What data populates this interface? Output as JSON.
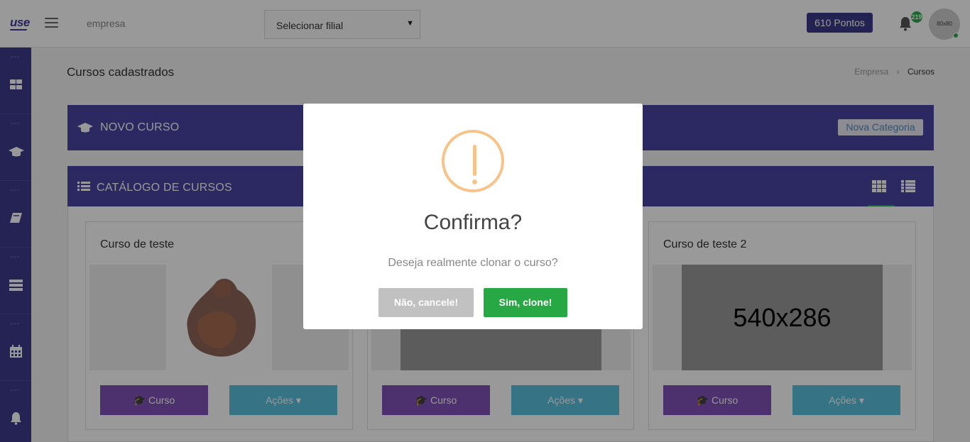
{
  "header": {
    "logo": "use",
    "company": "empresa",
    "branch_select": "Selecionar filial",
    "points": "610 Pontos",
    "notifications_count": "219",
    "avatar_text": "80x80"
  },
  "sidebar": {
    "items": [
      {
        "icon": "dashboard-icon",
        "dots": "---"
      },
      {
        "icon": "graduation-cap-icon",
        "dots": "---"
      },
      {
        "icon": "book-icon",
        "dots": "---"
      },
      {
        "icon": "server-icon",
        "dots": "---"
      },
      {
        "icon": "calendar-icon",
        "dots": "---"
      },
      {
        "icon": "bell-icon",
        "dots": "---"
      }
    ]
  },
  "page": {
    "title": "Cursos cadastrados",
    "breadcrumb": [
      "Empresa",
      "Cursos"
    ]
  },
  "new_course_panel": {
    "title": "NOVO CURSO",
    "new_category_label": "Nova Categoria"
  },
  "catalog_panel": {
    "title": "CATÁLOGO DE CURSOS"
  },
  "cards": [
    {
      "title": "Curso de teste",
      "image_label": "",
      "curso_label": "Curso",
      "acoes_label": "Ações"
    },
    {
      "title": "",
      "image_label": "",
      "curso_label": "Curso",
      "acoes_label": "Ações"
    },
    {
      "title": "Curso de teste 2",
      "image_label": "540x286",
      "curso_label": "Curso",
      "acoes_label": "Ações"
    }
  ],
  "modal": {
    "title": "Confirma?",
    "text": "Deseja realmente clonar o curso?",
    "cancel_label": "Não, cancele!",
    "confirm_label": "Sim, clone!"
  },
  "colors": {
    "primary": "#4a44a3",
    "sidebar": "#3f3a8d",
    "curso_button": "#7f52b8",
    "acoes_button": "#5bc0de",
    "confirm": "#28a745",
    "cancel": "#c1c1c1",
    "warning": "#f6c48a"
  }
}
